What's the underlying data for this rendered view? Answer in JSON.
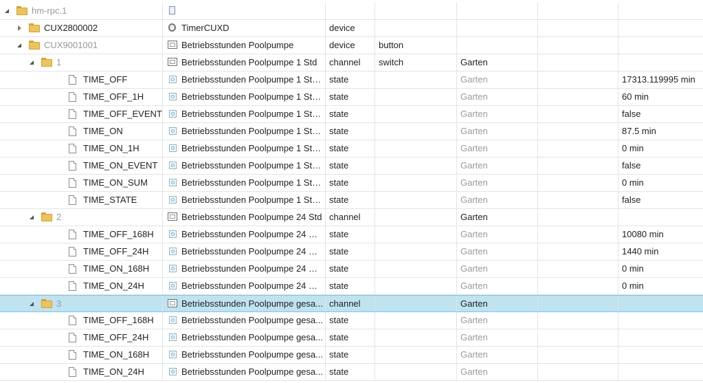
{
  "rows": [
    {
      "id": "hm-rpc.1",
      "depth": 0,
      "toggle": "open",
      "kind": "folder",
      "id_dim": true,
      "name": "",
      "icon": "document-icon",
      "type": "",
      "role": "",
      "room": "",
      "value": ""
    },
    {
      "id": "CUX2800002",
      "depth": 1,
      "toggle": "closed",
      "kind": "folder",
      "id_dim": false,
      "name": "TimerCUXD",
      "icon": "timer-icon",
      "type": "device",
      "role": "",
      "room": "",
      "value": ""
    },
    {
      "id": "CUX9001001",
      "depth": 1,
      "toggle": "open",
      "kind": "folder",
      "id_dim": true,
      "name": "Betriebsstunden Poolpumpe",
      "icon": "monitor-icon",
      "type": "device",
      "role": "button",
      "room": "",
      "value": ""
    },
    {
      "id": "1",
      "depth": 2,
      "toggle": "open",
      "kind": "folder",
      "id_dim": true,
      "name": "Betriebsstunden Poolpumpe 1 Std",
      "icon": "monitor-icon",
      "type": "channel",
      "role": "switch",
      "room": "Garten",
      "room_dim": false,
      "value": ""
    },
    {
      "id": "TIME_OFF",
      "depth": 3,
      "toggle": "",
      "kind": "file",
      "id_dim": false,
      "name": "Betriebsstunden Poolpumpe 1 Std...",
      "icon": "state-icon",
      "type": "state",
      "role": "",
      "room": "Garten",
      "room_dim": true,
      "value": "17313.119995 min"
    },
    {
      "id": "TIME_OFF_1H",
      "depth": 3,
      "toggle": "",
      "kind": "file",
      "id_dim": false,
      "name": "Betriebsstunden Poolpumpe 1 Std...",
      "icon": "state-icon",
      "type": "state",
      "role": "",
      "room": "Garten",
      "room_dim": true,
      "value": "60 min"
    },
    {
      "id": "TIME_OFF_EVENT",
      "depth": 3,
      "toggle": "",
      "kind": "file",
      "id_dim": false,
      "name": "Betriebsstunden Poolpumpe 1 Std...",
      "icon": "state-icon",
      "type": "state",
      "role": "",
      "room": "Garten",
      "room_dim": true,
      "value": "false"
    },
    {
      "id": "TIME_ON",
      "depth": 3,
      "toggle": "",
      "kind": "file",
      "id_dim": false,
      "name": "Betriebsstunden Poolpumpe 1 Std...",
      "icon": "state-icon",
      "type": "state",
      "role": "",
      "room": "Garten",
      "room_dim": true,
      "value": "87.5 min"
    },
    {
      "id": "TIME_ON_1H",
      "depth": 3,
      "toggle": "",
      "kind": "file",
      "id_dim": false,
      "name": "Betriebsstunden Poolpumpe 1 Std...",
      "icon": "state-icon",
      "type": "state",
      "role": "",
      "room": "Garten",
      "room_dim": true,
      "value": "0 min"
    },
    {
      "id": "TIME_ON_EVENT",
      "depth": 3,
      "toggle": "",
      "kind": "file",
      "id_dim": false,
      "name": "Betriebsstunden Poolpumpe 1 Std...",
      "icon": "state-icon",
      "type": "state",
      "role": "",
      "room": "Garten",
      "room_dim": true,
      "value": "false"
    },
    {
      "id": "TIME_ON_SUM",
      "depth": 3,
      "toggle": "",
      "kind": "file",
      "id_dim": false,
      "name": "Betriebsstunden Poolpumpe 1 Std...",
      "icon": "state-icon",
      "type": "state",
      "role": "",
      "room": "Garten",
      "room_dim": true,
      "value": "0 min"
    },
    {
      "id": "TIME_STATE",
      "depth": 3,
      "toggle": "",
      "kind": "file",
      "id_dim": false,
      "name": "Betriebsstunden Poolpumpe 1 Std...",
      "icon": "state-icon",
      "type": "state",
      "role": "",
      "room": "Garten",
      "room_dim": true,
      "value": "false"
    },
    {
      "id": "2",
      "depth": 2,
      "toggle": "open",
      "kind": "folder",
      "id_dim": true,
      "name": "Betriebsstunden Poolpumpe 24 Std",
      "icon": "monitor-icon",
      "type": "channel",
      "role": "",
      "room": "Garten",
      "room_dim": false,
      "value": ""
    },
    {
      "id": "TIME_OFF_168H",
      "depth": 3,
      "toggle": "",
      "kind": "file",
      "id_dim": false,
      "name": "Betriebsstunden Poolpumpe 24 St...",
      "icon": "state-icon",
      "type": "state",
      "role": "",
      "room": "Garten",
      "room_dim": true,
      "value": "10080 min"
    },
    {
      "id": "TIME_OFF_24H",
      "depth": 3,
      "toggle": "",
      "kind": "file",
      "id_dim": false,
      "name": "Betriebsstunden Poolpumpe 24 St...",
      "icon": "state-icon",
      "type": "state",
      "role": "",
      "room": "Garten",
      "room_dim": true,
      "value": "1440 min"
    },
    {
      "id": "TIME_ON_168H",
      "depth": 3,
      "toggle": "",
      "kind": "file",
      "id_dim": false,
      "name": "Betriebsstunden Poolpumpe 24 St...",
      "icon": "state-icon",
      "type": "state",
      "role": "",
      "room": "Garten",
      "room_dim": true,
      "value": "0 min"
    },
    {
      "id": "TIME_ON_24H",
      "depth": 3,
      "toggle": "",
      "kind": "file",
      "id_dim": false,
      "name": "Betriebsstunden Poolpumpe 24 St...",
      "icon": "state-icon",
      "type": "state",
      "role": "",
      "room": "Garten",
      "room_dim": true,
      "value": "0 min"
    },
    {
      "id": "3",
      "depth": 2,
      "toggle": "open",
      "kind": "folder",
      "id_dim": true,
      "selected": true,
      "name": "Betriebsstunden Poolpumpe gesa...",
      "icon": "monitor-icon",
      "type": "channel",
      "role": "",
      "room": "Garten",
      "room_dim": false,
      "value": ""
    },
    {
      "id": "TIME_OFF_168H",
      "depth": 3,
      "toggle": "",
      "kind": "file",
      "id_dim": false,
      "name": "Betriebsstunden Poolpumpe gesa...",
      "icon": "state-icon",
      "type": "state",
      "role": "",
      "room": "Garten",
      "room_dim": true,
      "value": ""
    },
    {
      "id": "TIME_OFF_24H",
      "depth": 3,
      "toggle": "",
      "kind": "file",
      "id_dim": false,
      "name": "Betriebsstunden Poolpumpe gesa...",
      "icon": "state-icon",
      "type": "state",
      "role": "",
      "room": "Garten",
      "room_dim": true,
      "value": ""
    },
    {
      "id": "TIME_ON_168H",
      "depth": 3,
      "toggle": "",
      "kind": "file",
      "id_dim": false,
      "name": "Betriebsstunden Poolpumpe gesa...",
      "icon": "state-icon",
      "type": "state",
      "role": "",
      "room": "Garten",
      "room_dim": true,
      "value": ""
    },
    {
      "id": "TIME_ON_24H",
      "depth": 3,
      "toggle": "",
      "kind": "file",
      "id_dim": false,
      "name": "Betriebsstunden Poolpumpe gesa...",
      "icon": "state-icon",
      "type": "state",
      "role": "",
      "room": "Garten",
      "room_dim": true,
      "value": ""
    }
  ]
}
